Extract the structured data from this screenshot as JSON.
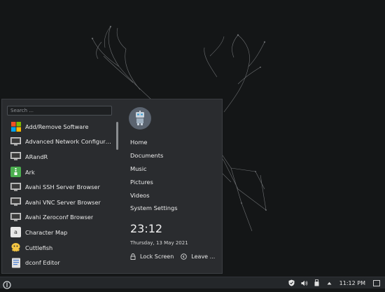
{
  "search": {
    "placeholder": "Search ..."
  },
  "apps": [
    {
      "label": "Add/Remove Software",
      "icon": "package-manager-icon"
    },
    {
      "label": "Advanced Network Configurat...",
      "icon": "network-config-icon"
    },
    {
      "label": "ARandR",
      "icon": "display-icon"
    },
    {
      "label": "Ark",
      "icon": "archive-icon"
    },
    {
      "label": "Avahi SSH Server Browser",
      "icon": "network-browser-icon"
    },
    {
      "label": "Avahi VNC Server Browser",
      "icon": "network-browser-icon"
    },
    {
      "label": "Avahi Zeroconf Browser",
      "icon": "network-browser-icon"
    },
    {
      "label": "Character Map",
      "icon": "character-map-icon"
    },
    {
      "label": "Cuttlefish",
      "icon": "cuttlefish-icon"
    },
    {
      "label": "dconf Editor",
      "icon": "dconf-editor-icon"
    }
  ],
  "places": [
    {
      "label": "Home"
    },
    {
      "label": "Documents"
    },
    {
      "label": "Music"
    },
    {
      "label": "Pictures"
    },
    {
      "label": "Videos"
    },
    {
      "label": "System Settings"
    }
  ],
  "clock": {
    "time": "23:12",
    "date": "Thursday, 13 May 2021"
  },
  "session": {
    "lock": "Lock Screen",
    "leave": "Leave ..."
  },
  "taskbar": {
    "time": "11:12 PM"
  },
  "colors": {
    "panel": "#2a2c2f",
    "desktop": "#141617",
    "taskbar": "#24272a"
  }
}
